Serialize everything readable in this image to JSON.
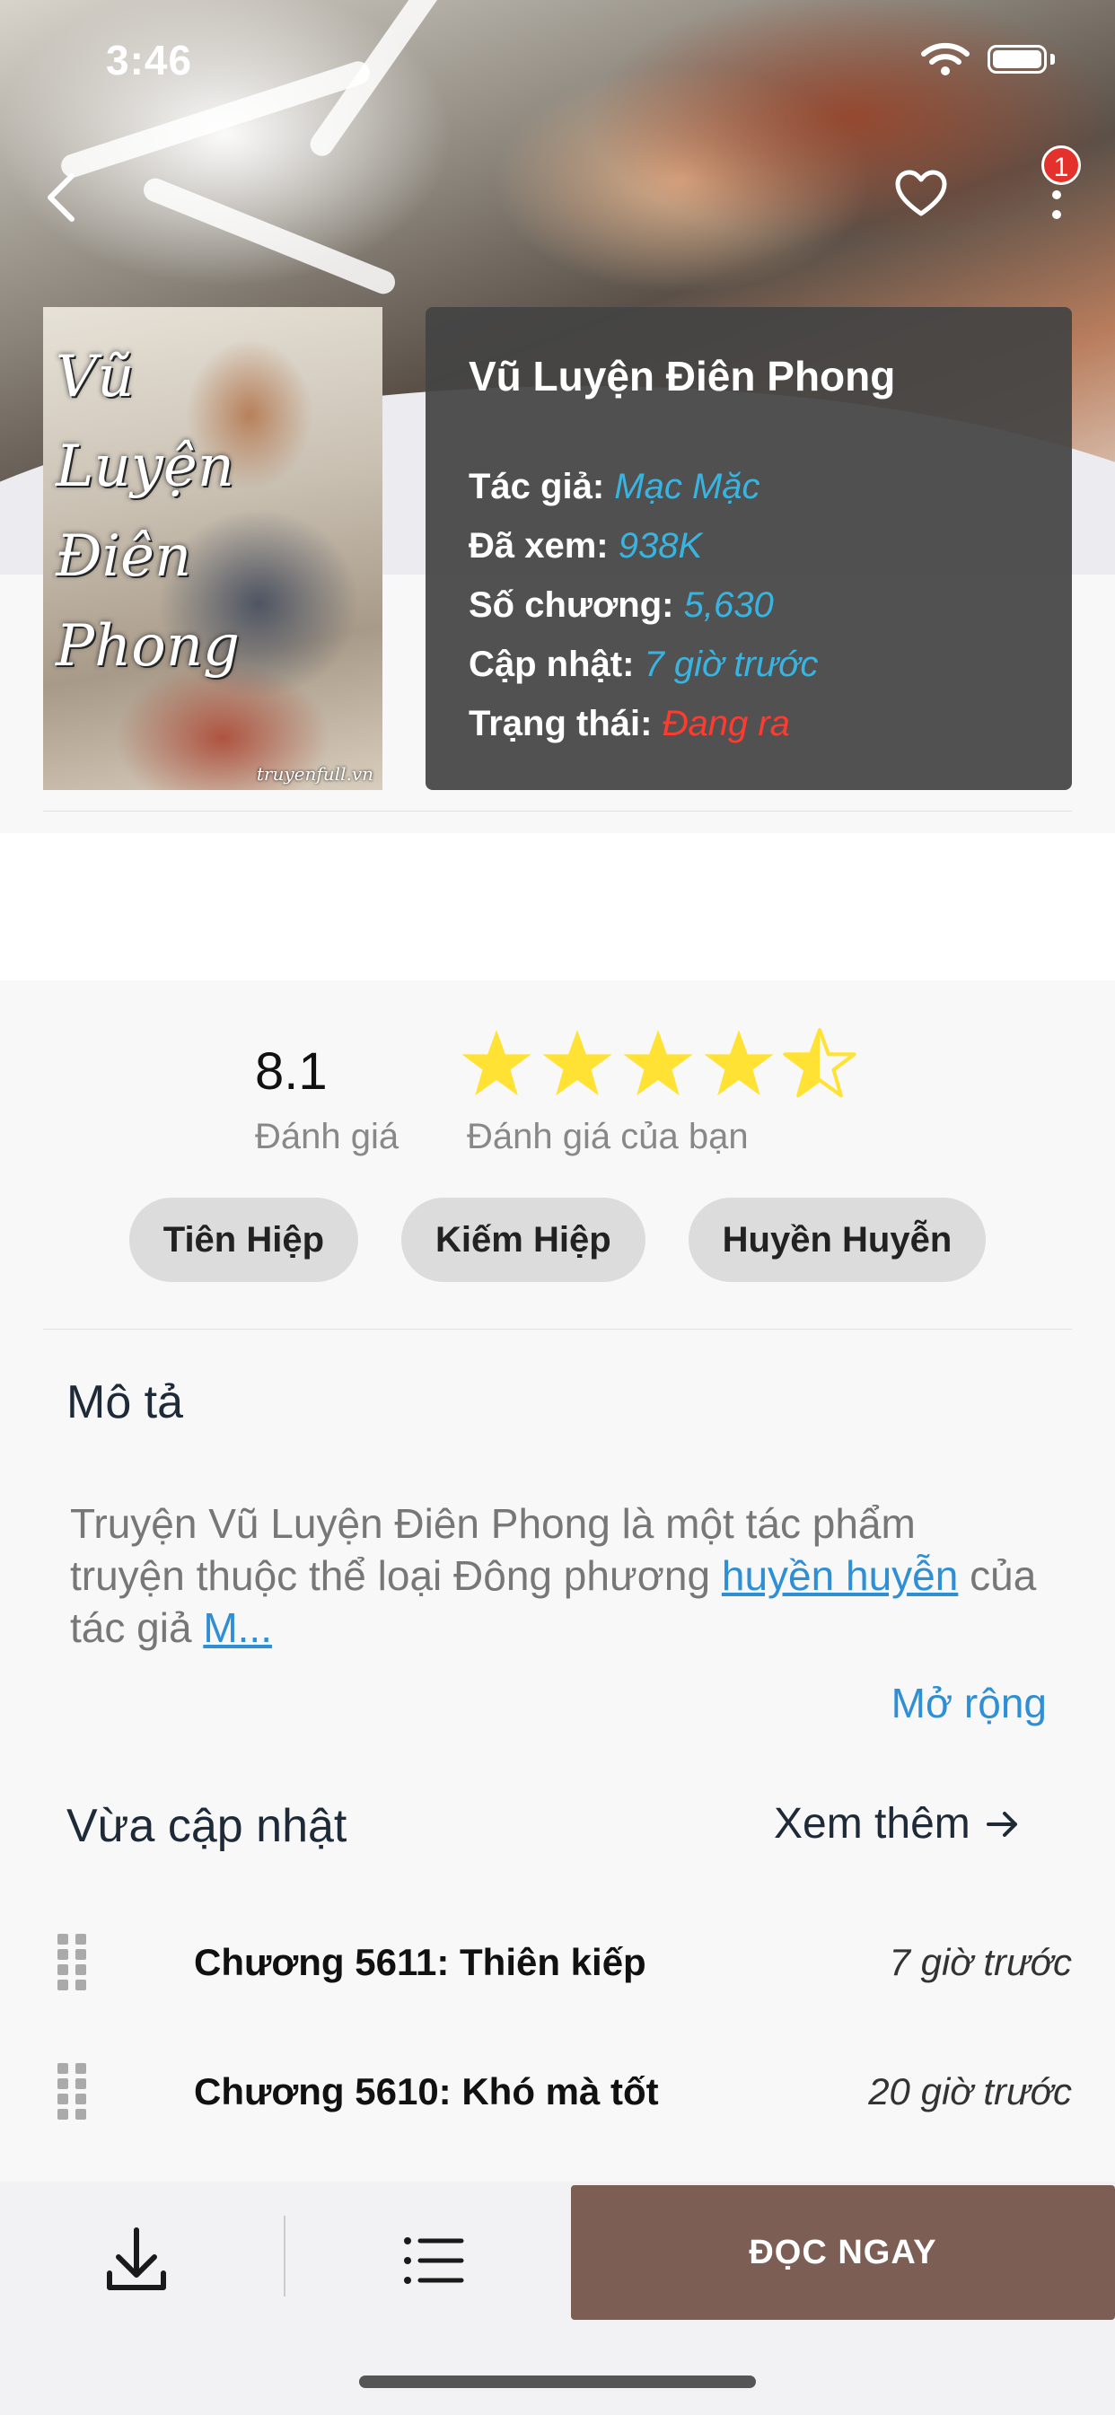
{
  "status_bar": {
    "time": "3:46"
  },
  "header": {
    "notification_count": "1"
  },
  "book": {
    "cover_title": "Vũ Luyện Điên Phong",
    "cover_watermark": "truyenfull.vn",
    "title": "Vũ Luyện Điên Phong",
    "author_label": "Tác giả:",
    "author": "Mạc Mặc",
    "views_label": "Đã xem:",
    "views": "938K",
    "chapters_label": "Số chương:",
    "chapters": "5,630",
    "updated_label": "Cập nhật:",
    "updated": "7 giờ trước",
    "status_label": "Trạng thái:",
    "status": "Đang ra"
  },
  "rating": {
    "score": "8.1",
    "score_label": "Đánh giá",
    "your_label": "Đánh giá của bạn",
    "stars": 4.5
  },
  "genres": [
    "Tiên Hiệp",
    "Kiếm Hiệp",
    "Huyền Huyễn"
  ],
  "description": {
    "title": "Mô tả",
    "text_part1": "Truyện Vũ Luyện Điên Phong là một tác phẩm truyện thuộc thể loại Đông phương ",
    "link_genre": "huyền huyễn",
    "text_part2": " của tác giả ",
    "link_author": "M...",
    "expand_label": "Mở rộng"
  },
  "updates": {
    "title": "Vừa cập nhật",
    "see_more": "Xem thêm",
    "chapters": [
      {
        "title": "Chương 5611: Thiên kiếp",
        "time": "7 giờ trước"
      },
      {
        "title": "Chương 5610: Khó mà tốt",
        "time": "20 giờ trước"
      }
    ]
  },
  "bottom_bar": {
    "read_now": "ĐỌC NGAY"
  },
  "colors": {
    "accent_link": "#2f8fd6",
    "info_value": "#39b4e0",
    "status_red": "#ff3b30",
    "read_button": "#7c5e54",
    "star": "#ffe234"
  }
}
